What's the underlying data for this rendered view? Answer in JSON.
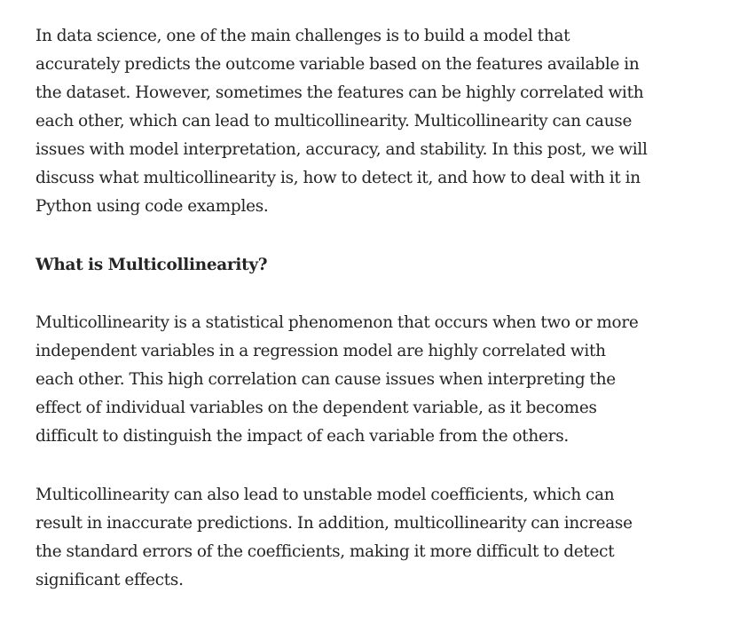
{
  "article": {
    "intro": "In data science, one of the main challenges is to build a model that accurately predicts the outcome variable based on the features available in the dataset. However, sometimes the features can be highly correlated with each other, which can lead to multicollinearity. Multicollinearity can cause issues with model interpretation, accuracy, and stability. In this post, we will discuss what multicollinearity is, how to detect it, and how to deal with it in Python using code examples.",
    "heading": "What is Multicollinearity?",
    "paragraph_1": "Multicollinearity is a statistical phenomenon that occurs when two or more independent variables in a regression model are highly correlated with each other. This high correlation can cause issues when interpreting the effect of individual variables on the dependent variable, as it becomes difficult to distinguish the impact of each variable from the others.",
    "paragraph_2": "Multicollinearity can also lead to unstable model coefficients, which can result in inaccurate predictions. In addition, multicollinearity can increase the standard errors of the coefficients, making it more difficult to detect significant effects."
  }
}
